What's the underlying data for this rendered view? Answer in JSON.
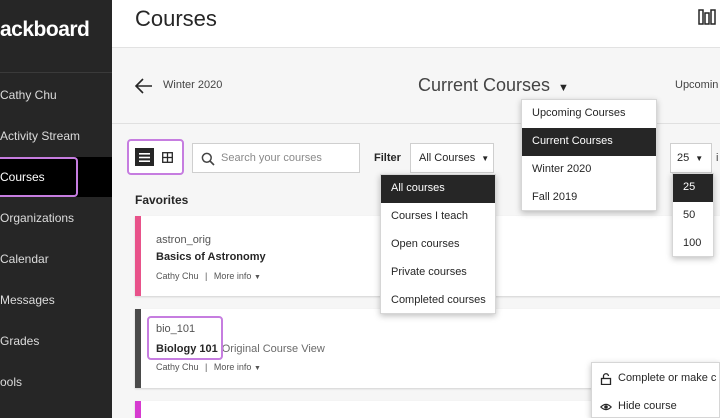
{
  "sidebar": {
    "brand": "ackboard",
    "items": [
      {
        "label": "Cathy Chu"
      },
      {
        "label": "Activity Stream"
      },
      {
        "label": "Courses"
      },
      {
        "label": "Organizations"
      },
      {
        "label": "Calendar"
      },
      {
        "label": "Messages"
      },
      {
        "label": "Grades"
      },
      {
        "label": "ools"
      }
    ]
  },
  "header": {
    "title": "Courses"
  },
  "term_bar": {
    "previous": "Winter 2020",
    "current": "Current Courses",
    "next": "Upcomin"
  },
  "term_menu": {
    "items": [
      "Upcoming Courses",
      "Current Courses",
      "Winter 2020",
      "Fall 2019"
    ]
  },
  "toolbar": {
    "search_placeholder": "Search your courses",
    "filter_label": "Filter",
    "filter_value": "All Courses",
    "per_page_value": "25",
    "per_page_tail": "i"
  },
  "filter_menu": {
    "items": [
      "All courses",
      "Courses I teach",
      "Open courses",
      "Private courses",
      "Completed courses"
    ]
  },
  "per_page_menu": {
    "items": [
      "25",
      "50",
      "100"
    ]
  },
  "favorites_label": "Favorites",
  "courses": [
    {
      "id": "astron_orig",
      "name": "Basics of Astronomy",
      "instructor": "Cathy Chu",
      "separator": "|",
      "more": "More info",
      "view": "",
      "color": "#e8528a"
    },
    {
      "id": "bio_101",
      "name": "Biology 101",
      "instructor": "Cathy Chu",
      "separator": "|",
      "more": "More info",
      "view": "Original Course View",
      "color": "#4a4a4a"
    }
  ],
  "context_menu": {
    "items": [
      {
        "label": "Complete or make c",
        "icon": "lock-open-icon"
      },
      {
        "label": "Hide course",
        "icon": "eye-icon"
      }
    ]
  },
  "colors": {
    "sidebar_bg": "#262626",
    "highlight": "#c67de0",
    "third_stripe": "#d63bd0"
  }
}
